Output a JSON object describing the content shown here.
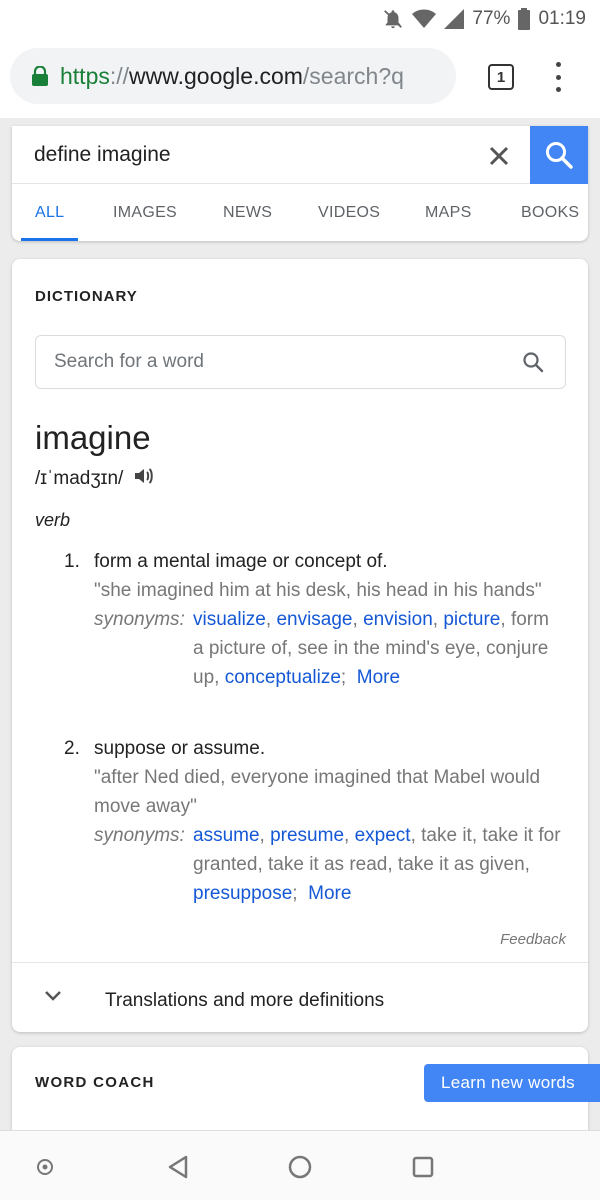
{
  "status_bar": {
    "battery": "77%",
    "time": "01:19"
  },
  "browser": {
    "url_scheme": "https",
    "url_sep": "://",
    "url_host": "www.google.com",
    "url_path": "/search?q",
    "tab_count": "1"
  },
  "search": {
    "query": "define imagine",
    "tabs": [
      {
        "label": "ALL",
        "active": true
      },
      {
        "label": "IMAGES"
      },
      {
        "label": "NEWS"
      },
      {
        "label": "VIDEOS"
      },
      {
        "label": "MAPS"
      },
      {
        "label": "BOOKS"
      }
    ]
  },
  "dictionary": {
    "heading": "DICTIONARY",
    "word_search_placeholder": "Search for a word",
    "headword": "imagine",
    "phonetic": "/ɪˈmadʒɪn/",
    "part_of_speech": "verb",
    "senses": [
      {
        "number": "1.",
        "definition": "form a mental image or concept of.",
        "example": "\"she imagined him at his desk, his head in his hands\"",
        "synonyms_label": "synonyms:",
        "synonyms": [
          {
            "text": "visualize",
            "link": true
          },
          {
            "text": "envisage",
            "link": true
          },
          {
            "text": "envision",
            "link": true
          },
          {
            "text": "picture",
            "link": true
          },
          {
            "text": "form a picture of",
            "link": false
          },
          {
            "text": "see in the mind's eye",
            "link": false
          },
          {
            "text": "conjure up",
            "link": false
          },
          {
            "text": "conceptualize",
            "link": true
          }
        ],
        "more": "More"
      },
      {
        "number": "2.",
        "definition": "suppose or assume.",
        "example": "\"after Ned died, everyone imagined that Mabel would move away\"",
        "synonyms_label": "synonyms:",
        "synonyms": [
          {
            "text": "assume",
            "link": true
          },
          {
            "text": "presume",
            "link": true
          },
          {
            "text": "expect",
            "link": true
          },
          {
            "text": "take it",
            "link": false
          },
          {
            "text": "take it for granted",
            "link": false
          },
          {
            "text": "take it as read",
            "link": false
          },
          {
            "text": "take it as given",
            "link": false
          },
          {
            "text": "presuppose",
            "link": true
          }
        ],
        "more": "More"
      }
    ],
    "feedback": "Feedback",
    "translations": "Translations and more definitions"
  },
  "word_coach": {
    "title": "WORD COACH",
    "button": "Learn new words"
  },
  "colors": {
    "accent": "#4285f4",
    "link": "#1558d6",
    "secure_green": "#188038"
  }
}
